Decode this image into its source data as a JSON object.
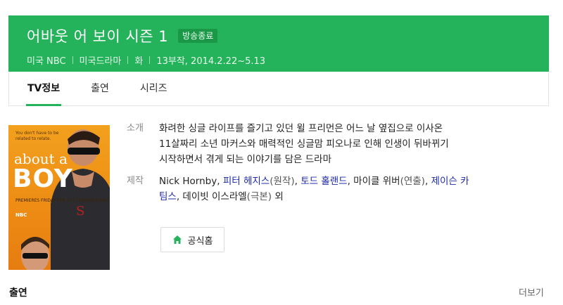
{
  "header": {
    "title": "어바웃 어 보이 시즌 1",
    "badge": "방송종료",
    "meta": [
      "미국 NBC",
      "미국드라마",
      "화",
      "13부작, 2014.2.22~5.13"
    ],
    "bg_color": "#24b35a"
  },
  "tabs": [
    {
      "label": "TV정보",
      "active": true
    },
    {
      "label": "출연",
      "active": false
    },
    {
      "label": "시리즈",
      "active": false
    }
  ],
  "poster": {
    "tagline": "You don't have to be related to relate.",
    "title_top": "about a",
    "title_bottom": "BOY",
    "premieres": "PREMIERES FRIDAY FEB 21 / TUESDAYS 9/8c",
    "network": "NBC"
  },
  "info": {
    "synopsis_label": "소개",
    "synopsis_lines": [
      "화려한 싱글 라이프를 즐기고 있던 윌 프리먼은 어느 날 옆집으로 이사온",
      "11살짜리 소년 마커스와 매력적인 싱글맘 피오나로 인해 인생이 뒤바뀌기",
      "시작하면서 겪게 되는 이야기를 담은 드라마"
    ],
    "production_label": "제작",
    "production": {
      "p1": "Nick Hornby, ",
      "link1": "피터 헤지스",
      "role1": "(원작)",
      "sep1": ", ",
      "link2": "토드 홀랜드",
      "sep2": ", 마이클 위버",
      "role2": "(연출)",
      "sep3": ", ",
      "link3": "제이슨 카",
      "link3b": "팀스",
      "sep4": ", 데이빗 이스라엘",
      "role3": "(극본)",
      "tail": " 외"
    }
  },
  "official_home_button": {
    "label": "공식홈",
    "icon": "home-icon"
  },
  "cast_section": {
    "title": "출연",
    "more": "더보기"
  }
}
